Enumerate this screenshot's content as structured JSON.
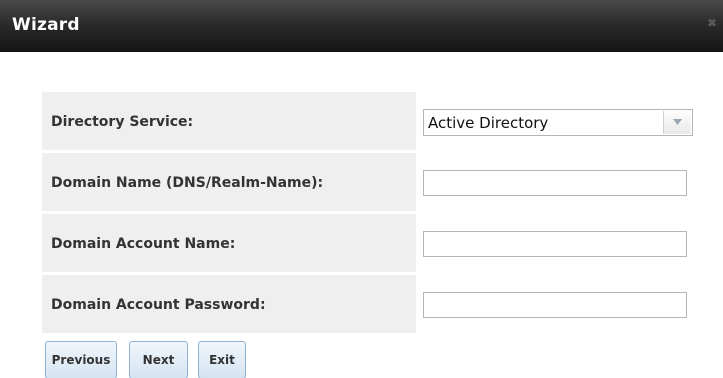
{
  "window": {
    "title": "Wizard",
    "close_glyph": "✖"
  },
  "form": {
    "rows": [
      {
        "label": "Directory Service:",
        "type": "select",
        "value": "Active Directory"
      },
      {
        "label": "Domain Name (DNS/Realm-Name):",
        "type": "text",
        "value": "",
        "placeholder": ""
      },
      {
        "label": "Domain Account Name:",
        "type": "text",
        "value": "",
        "placeholder": ""
      },
      {
        "label": "Domain Account Password:",
        "type": "password",
        "value": "",
        "placeholder": ""
      }
    ]
  },
  "buttons": {
    "previous": "Previous",
    "next": "Next",
    "exit": "Exit"
  },
  "icons": {
    "close": "close-icon",
    "dropdown": "chevron-down-icon"
  },
  "colors": {
    "titlebar": "#2b2b2b",
    "label_cell": "#efefef",
    "button_fill": "#d5e4f2",
    "button_border": "#8fb2d2"
  }
}
